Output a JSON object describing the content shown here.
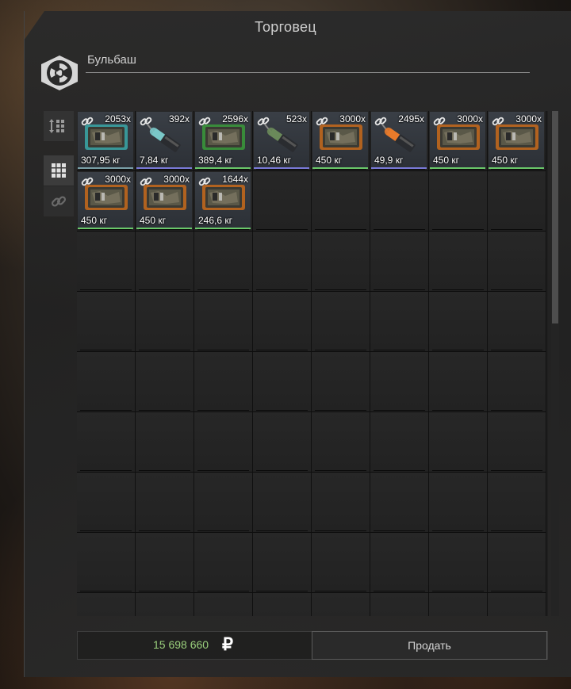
{
  "window": {
    "title": "Торговец",
    "trader_name": "Бульбаш"
  },
  "sidebar": {
    "sort_icon": "sort-grid-icon",
    "grid_icon": "grid-view-icon",
    "link_icon": "chain-link-icon"
  },
  "items": [
    {
      "count": "2053x",
      "weight": "307,95 кг",
      "type": "crate",
      "accent": "#3aa8a8",
      "underline": "#7aa0a8"
    },
    {
      "count": "392x",
      "weight": "7,84 кг",
      "type": "cylinder",
      "accent": "#7ac8c8",
      "underline": "#7a7ad8"
    },
    {
      "count": "2596x",
      "weight": "389,4 кг",
      "type": "crate",
      "accent": "#3a9a3a",
      "underline": "#6ac86a"
    },
    {
      "count": "523x",
      "weight": "10,46 кг",
      "type": "cylinder",
      "accent": "#6a8a5a",
      "underline": "#7a7ad8"
    },
    {
      "count": "3000x",
      "weight": "450 кг",
      "type": "crate",
      "accent": "#c86a1a",
      "underline": "#6ac86a"
    },
    {
      "count": "2495x",
      "weight": "49,9 кг",
      "type": "cylinder",
      "accent": "#e87a2a",
      "underline": "#7a7ad8"
    },
    {
      "count": "3000x",
      "weight": "450 кг",
      "type": "crate",
      "accent": "#c86a1a",
      "underline": "#6ac86a"
    },
    {
      "count": "3000x",
      "weight": "450 кг",
      "type": "crate",
      "accent": "#c86a1a",
      "underline": "#6ac86a"
    },
    {
      "count": "3000x",
      "weight": "450 кг",
      "type": "crate",
      "accent": "#c86a1a",
      "underline": "#6ac86a"
    },
    {
      "count": "3000x",
      "weight": "450 кг",
      "type": "crate",
      "accent": "#c86a1a",
      "underline": "#6ac86a"
    },
    {
      "count": "1644x",
      "weight": "246,6 кг",
      "type": "crate",
      "accent": "#c86a1a",
      "underline": "#6ac86a"
    }
  ],
  "footer": {
    "balance": "15 698 660",
    "currency_symbol": "₽",
    "sell_label": "Продать"
  }
}
